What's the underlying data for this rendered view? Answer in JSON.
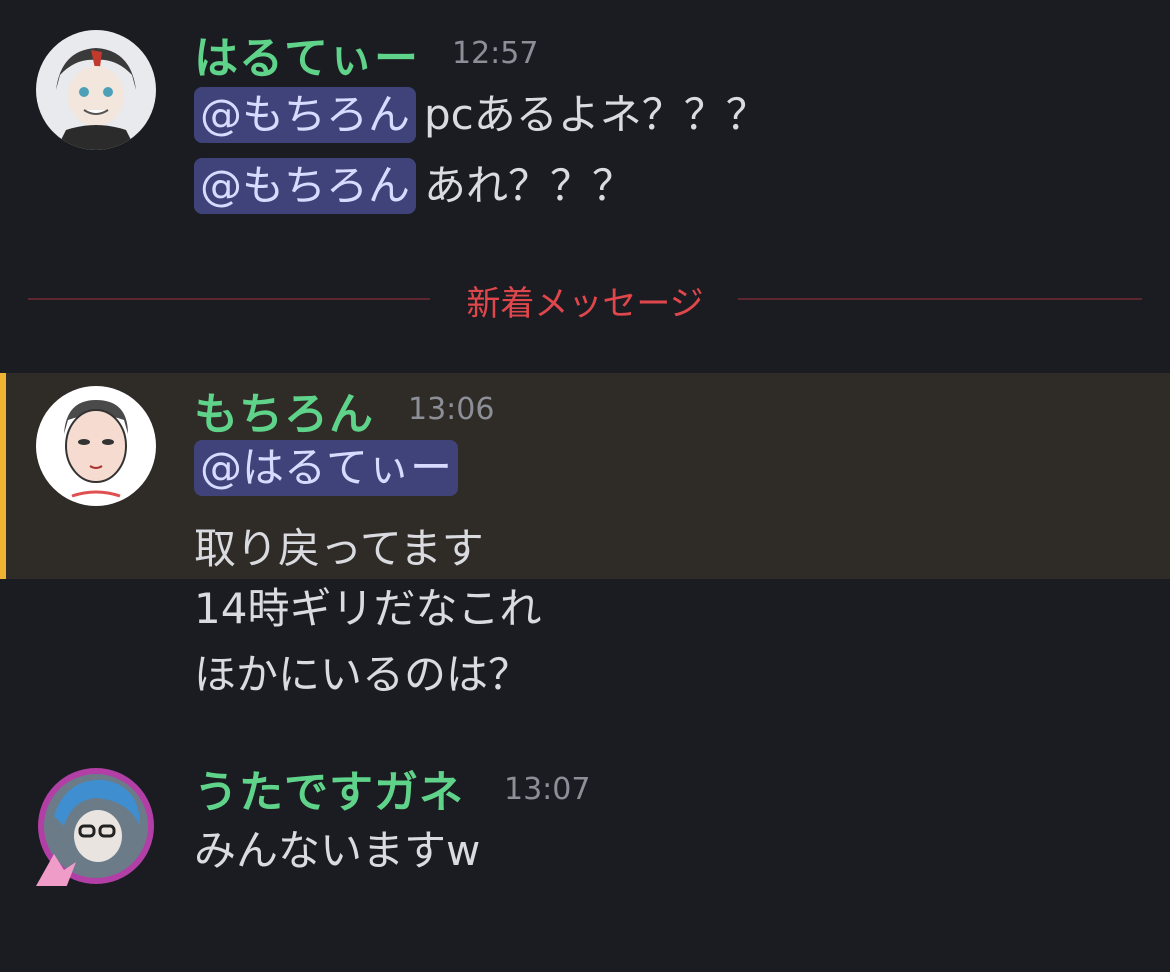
{
  "messages": [
    {
      "username": "はるてぃー",
      "time": "12:57",
      "lines": [
        {
          "mention": "@もちろん",
          "text": "pcあるよネ？？？"
        },
        {
          "mention": "@もちろん",
          "text": "あれ？？？"
        }
      ]
    },
    {
      "username": "もちろん",
      "time": "13:06",
      "lines": [
        {
          "mention": "@はるてぃー"
        },
        {
          "text": "取り戻ってます"
        },
        {
          "text": "14時ギリだなこれ"
        },
        {
          "text": "ほかにいるのは？"
        }
      ]
    },
    {
      "username": "うたですガネ",
      "time": "13:07",
      "lines": [
        {
          "text": "みんないますw"
        }
      ]
    }
  ],
  "new_messages_divider": "新着メッセージ",
  "colors": {
    "background": "#1b1c21",
    "username": "#5fd38a",
    "mention_bg": "#3f437a",
    "highlight_bg": "#2f2b26",
    "highlight_bar": "#f0b232",
    "divider": "#e0474c"
  }
}
